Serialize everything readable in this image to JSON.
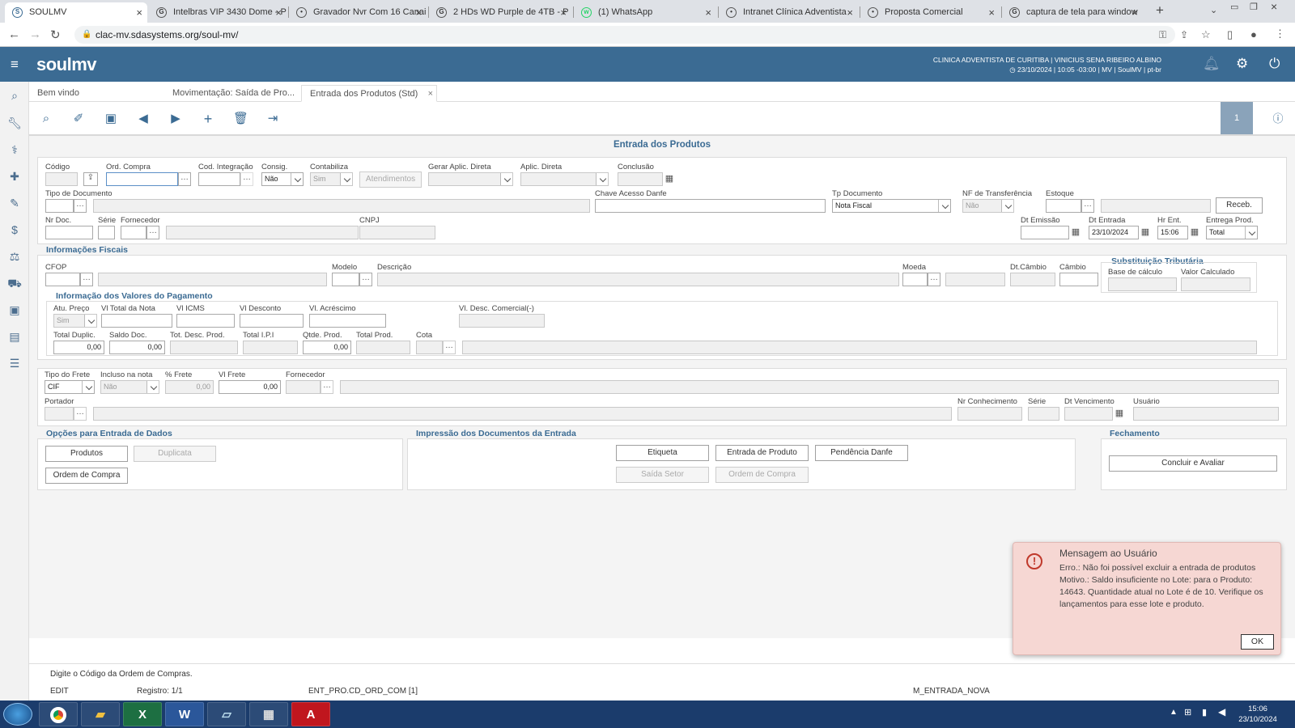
{
  "browser": {
    "tabs": [
      {
        "title": "SOULMV",
        "fav": "S"
      },
      {
        "title": "Intelbras VIP 3430 Dome - P",
        "fav": "G"
      },
      {
        "title": "Gravador Nvr Com 16 Canai",
        "fav": "•"
      },
      {
        "title": "2 HDs WD Purple de 4TB - P",
        "fav": "G"
      },
      {
        "title": "(1) WhatsApp",
        "fav": "w"
      },
      {
        "title": "Intranet Clínica Adventista",
        "fav": "•"
      },
      {
        "title": "Proposta Comercial",
        "fav": "•"
      },
      {
        "title": "captura de tela para window",
        "fav": "G"
      }
    ],
    "url": "clac-mv.sdasystems.org/soul-mv/"
  },
  "header": {
    "logo": "soulmv",
    "org_line1": "CLINICA ADVENTISTA DE CURITIBA | VINICIUS SENA RIBEIRO ALBINO",
    "org_line2": "23/10/2024 | 10:05 -03:00 | MV | SoulMV | pt-br"
  },
  "app_tabs": {
    "home": "Bem vindo",
    "movimentacao": "Movimentação: Saída de Pro...",
    "entrada": "Entrada dos Produtos (Std)"
  },
  "toolbar": {
    "page": "1"
  },
  "form": {
    "title": "Entrada dos Produtos",
    "labels": {
      "codigo": "Código",
      "ord_compra": "Ord. Compra",
      "cod_integracao": "Cod. Integração",
      "consig": "Consig.",
      "contabiliza": "Contabiliza",
      "gerar_aplic": "Gerar Aplic. Direta",
      "aplic_direta": "Aplic. Direta",
      "conclusao": "Conclusão",
      "tipo_doc": "Tipo de Documento",
      "chave_danfe": "Chave Acesso Danfe",
      "tp_documento": "Tp Documento",
      "nf_transf": "NF de Transferência",
      "estoque": "Estoque",
      "nr_doc": "Nr Doc.",
      "serie": "Série",
      "fornecedor": "Fornecedor",
      "cnpj": "CNPJ",
      "dt_emissao": "Dt Emissão",
      "dt_entrada": "Dt Entrada",
      "hr_ent": "Hr Ent.",
      "entrega_prod": "Entrega Prod."
    },
    "values": {
      "consig": "Não",
      "contabiliza": "Sim",
      "tp_documento": "Nota Fiscal",
      "nf_transf": "Não",
      "dt_entrada": "23/10/2024",
      "hr_ent": "15:06",
      "entrega_prod": "Total"
    },
    "buttons": {
      "atendimentos": "Atendimentos",
      "receb": "Receb."
    }
  },
  "fiscal": {
    "title": "Informações Fiscais",
    "labels": {
      "cfop": "CFOP",
      "modelo": "Modelo",
      "descricao": "Descrição",
      "moeda": "Moeda",
      "dt_cambio": "Dt.Câmbio",
      "cambio": "Câmbio"
    },
    "subst_title": "Substituição Tributária",
    "subst_labels": {
      "base": "Base de cálculo",
      "valor": "Valor Calculado"
    }
  },
  "pagamento": {
    "title": "Informação dos Valores do Pagamento",
    "labels": {
      "atu_preco": "Atu. Preço",
      "vl_total_nota": "Vl Total da Nota",
      "vl_icms": "Vl ICMS",
      "vl_desconto": "Vl Desconto",
      "vl_acrescimo": "Vl. Acréscimo",
      "vl_desc_comercial": "Vl. Desc. Comercial(-)",
      "total_duplic": "Total Duplic.",
      "saldo_doc": "Saldo Doc.",
      "tot_desc_prod": "Tot. Desc. Prod.",
      "total_ipi": "Total I.P.I",
      "qtde_prod": "Qtde. Prod.",
      "total_prod": "Total Prod.",
      "cota": "Cota"
    },
    "values": {
      "atu_preco": "Sim",
      "total_duplic": "0,00",
      "saldo_doc": "0,00",
      "qtde_prod": "0,00"
    }
  },
  "frete": {
    "labels": {
      "tipo_frete": "Tipo do Frete",
      "incluso": "Incluso na nota",
      "perc_frete": "% Frete",
      "vl_frete": "Vl Frete",
      "fornecedor": "Fornecedor",
      "portador": "Portador",
      "nr_conhecimento": "Nr Conhecimento",
      "serie": "Série",
      "dt_vencimento": "Dt Vencimento",
      "usuario": "Usuário"
    },
    "values": {
      "tipo_frete": "CIF",
      "incluso": "Não",
      "perc_frete": "0,00",
      "vl_frete": "0,00"
    }
  },
  "opcoes": {
    "title": "Opções para Entrada de Dados",
    "produtos": "Produtos",
    "duplicata": "Duplicata",
    "ordem_compra": "Ordem de Compra"
  },
  "impressao": {
    "title": "Impressão dos Documentos da Entrada",
    "etiqueta": "Etiqueta",
    "entrada_produto": "Entrada de Produto",
    "pendencia_danfe": "Pendência Danfe",
    "saida_setor": "Saída Setor",
    "ordem_compra": "Ordem de Compra"
  },
  "fechamento": {
    "title": "Fechamento",
    "concluir": "Concluir e Avaliar"
  },
  "status": {
    "hint": "Digite o Código da Ordem de Compras.",
    "mode": "EDIT",
    "registro": "Registro: 1/1",
    "field": "ENT_PRO.CD_ORD_COM [1]",
    "form": "M_ENTRADA_NOVA"
  },
  "dialog": {
    "title": "Mensagem ao Usuário",
    "line1": "Erro.: Não foi possível excluir a entrada de produtos",
    "line2": "Motivo.: Saldo insuficiente no Lote: para o Produto: 14643. Quantidade atual no Lote é de 10. Verifique os lançamentos para esse lote e produto.",
    "ok": "OK"
  },
  "taskbar": {
    "time": "15:06",
    "date": "23/10/2024"
  },
  "colors": {
    "header": "#3b6b93",
    "section": "#3b6b93",
    "dialog_bg": "#f6d7d3",
    "taskbar": "#1b3c6c"
  }
}
